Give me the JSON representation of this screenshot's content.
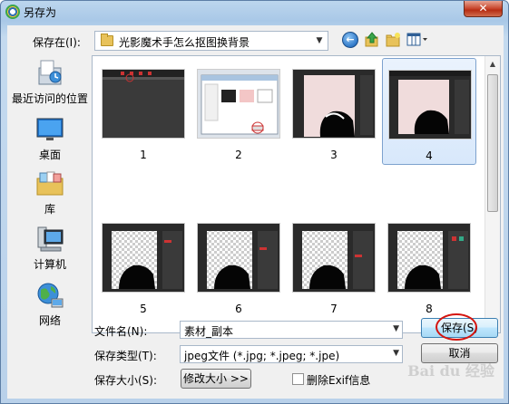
{
  "window": {
    "title": "另存为",
    "close": "✕"
  },
  "toolbar": {
    "save_in_label": "保存在(I):",
    "current_folder": "光影魔术手怎么抠图换背景",
    "dropdown_arrow": "▼",
    "icons": [
      "back-icon",
      "up-folder-icon",
      "new-folder-icon",
      "views-menu-icon"
    ]
  },
  "places": [
    {
      "label": "最近访问的位置",
      "icon": "recent-places-icon"
    },
    {
      "label": "桌面",
      "icon": "desktop-icon"
    },
    {
      "label": "库",
      "icon": "libraries-icon"
    },
    {
      "label": "计算机",
      "icon": "computer-icon"
    },
    {
      "label": "网络",
      "icon": "network-icon"
    }
  ],
  "files": [
    {
      "label": "1",
      "selected": false
    },
    {
      "label": "2",
      "selected": false
    },
    {
      "label": "3",
      "selected": false
    },
    {
      "label": "4",
      "selected": true
    },
    {
      "label": "5",
      "selected": false
    },
    {
      "label": "6",
      "selected": false
    },
    {
      "label": "7",
      "selected": false
    },
    {
      "label": "8",
      "selected": false
    }
  ],
  "form": {
    "filename_label": "文件名(N):",
    "filename_value": "素材_副本",
    "filetype_label": "保存类型(T):",
    "filetype_value": "jpeg文件 (*.jpg; *.jpeg; *.jpe)",
    "filesize_label": "保存大小(S):",
    "resize_button": "修改大小 >>",
    "remove_exif_label": "删除Exif信息",
    "remove_exif_checked": false
  },
  "buttons": {
    "save": "保存(S)",
    "cancel": "取消"
  },
  "watermark": "Bai du 经验",
  "colors": {
    "selection_border": "#7da2ce",
    "annotation_red": "#d4140e"
  }
}
